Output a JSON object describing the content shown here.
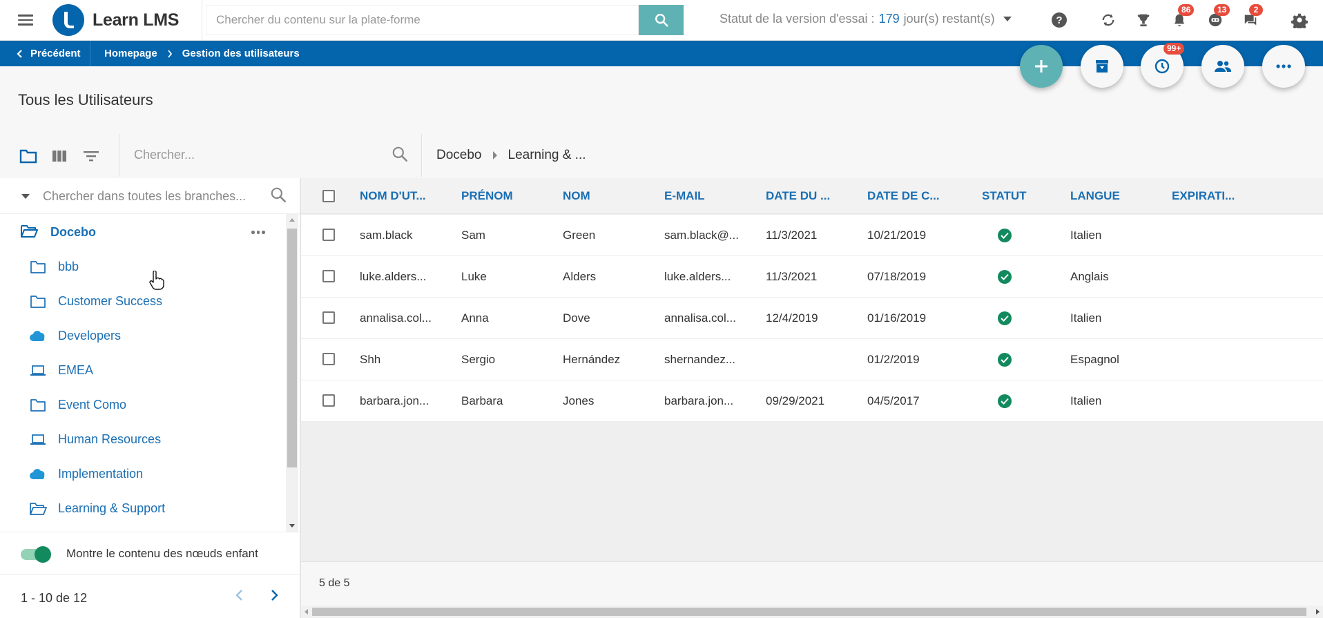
{
  "app": {
    "name": "Learn LMS",
    "search_placeholder": "Chercher du contenu sur la plate-forme",
    "trial_prefix": "Statut de la version d'essai : ",
    "trial_days": "179",
    "trial_suffix": " jour(s) restant(s)",
    "badges": {
      "notifications": "86",
      "messages": "13",
      "chat": "2",
      "history": "99+"
    }
  },
  "breadcrumb": {
    "back_label": "Précédent",
    "items": [
      "Homepage",
      "Gestion des utilisateurs"
    ]
  },
  "page": {
    "title": "Tous les Utilisateurs"
  },
  "users_toolbar": {
    "search_placeholder": "Chercher...",
    "path": [
      "Docebo",
      "Learning & ..."
    ]
  },
  "tree": {
    "search_placeholder": "Chercher dans toutes les branches...",
    "root": "Docebo",
    "branches": [
      {
        "label": "bbb",
        "icon": "folder-icon"
      },
      {
        "label": "Customer Success",
        "icon": "folder-icon"
      },
      {
        "label": "Developers",
        "icon": "cloud-icon"
      },
      {
        "label": "EMEA",
        "icon": "laptop-icon"
      },
      {
        "label": "Event Como",
        "icon": "folder-icon"
      },
      {
        "label": "Human Resources",
        "icon": "laptop-icon"
      },
      {
        "label": "Implementation",
        "icon": "cloud-icon"
      },
      {
        "label": "Learning & Support",
        "icon": "folder-open-icon"
      }
    ],
    "toggle_label": "Montre le contenu des nœuds enfant",
    "pager_text": "1 - 10 de 12"
  },
  "table": {
    "columns": [
      "NOM D'UT...",
      "PRÉNOM",
      "NOM",
      "E-MAIL",
      "DATE DU ...",
      "DATE DE C...",
      "STATUT",
      "LANGUE",
      "EXPIRATI..."
    ],
    "rows": [
      {
        "username": "sam.black",
        "first": "Sam",
        "last": "Green",
        "email": "sam.black@...",
        "date1": "11/3/2021",
        "date2": "10/21/2019",
        "status": "active",
        "lang": "Italien",
        "exp": ""
      },
      {
        "username": "luke.alders...",
        "first": "Luke",
        "last": "Alders",
        "email": "luke.alders...",
        "date1": "11/3/2021",
        "date2": "07/18/2019",
        "status": "active",
        "lang": "Anglais",
        "exp": ""
      },
      {
        "username": "annalisa.col...",
        "first": "Anna",
        "last": "Dove",
        "email": "annalisa.col...",
        "date1": "12/4/2019",
        "date2": "01/16/2019",
        "status": "active",
        "lang": "Italien",
        "exp": ""
      },
      {
        "username": "Shh",
        "first": "Sergio",
        "last": "Hernández",
        "email": "shernandez...",
        "date1": "",
        "date2": "01/2/2019",
        "status": "active",
        "lang": "Espagnol",
        "exp": ""
      },
      {
        "username": "barbara.jon...",
        "first": "Barbara",
        "last": "Jones",
        "email": "barbara.jon...",
        "date1": "09/29/2021",
        "date2": "04/5/2017",
        "status": "active",
        "lang": "Italien",
        "exp": ""
      }
    ],
    "footer_count": "5 de 5"
  },
  "colors": {
    "brand_blue": "#0465ac",
    "teal": "#5fb2b4",
    "link_blue": "#1a6fb4",
    "status_green": "#128a5e",
    "badge_red": "#e84c3d"
  }
}
